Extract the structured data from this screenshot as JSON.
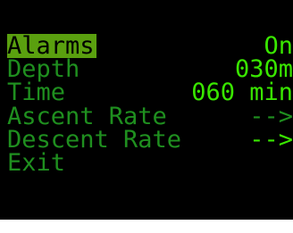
{
  "colors": {
    "background": "#000000",
    "highlight": "#5aa00f",
    "bright_text": "#39e600",
    "dim_text": "#1f8f1f"
  },
  "menu": {
    "items": [
      {
        "label": "Alarms",
        "value": "On",
        "selected": true
      },
      {
        "label": "Depth",
        "value": "030m"
      },
      {
        "label": "Time",
        "value": "060 min"
      },
      {
        "label": "Ascent Rate",
        "value": "-->"
      },
      {
        "label": "Descent Rate",
        "value": "-->"
      },
      {
        "label": "Exit",
        "value": ""
      }
    ]
  }
}
